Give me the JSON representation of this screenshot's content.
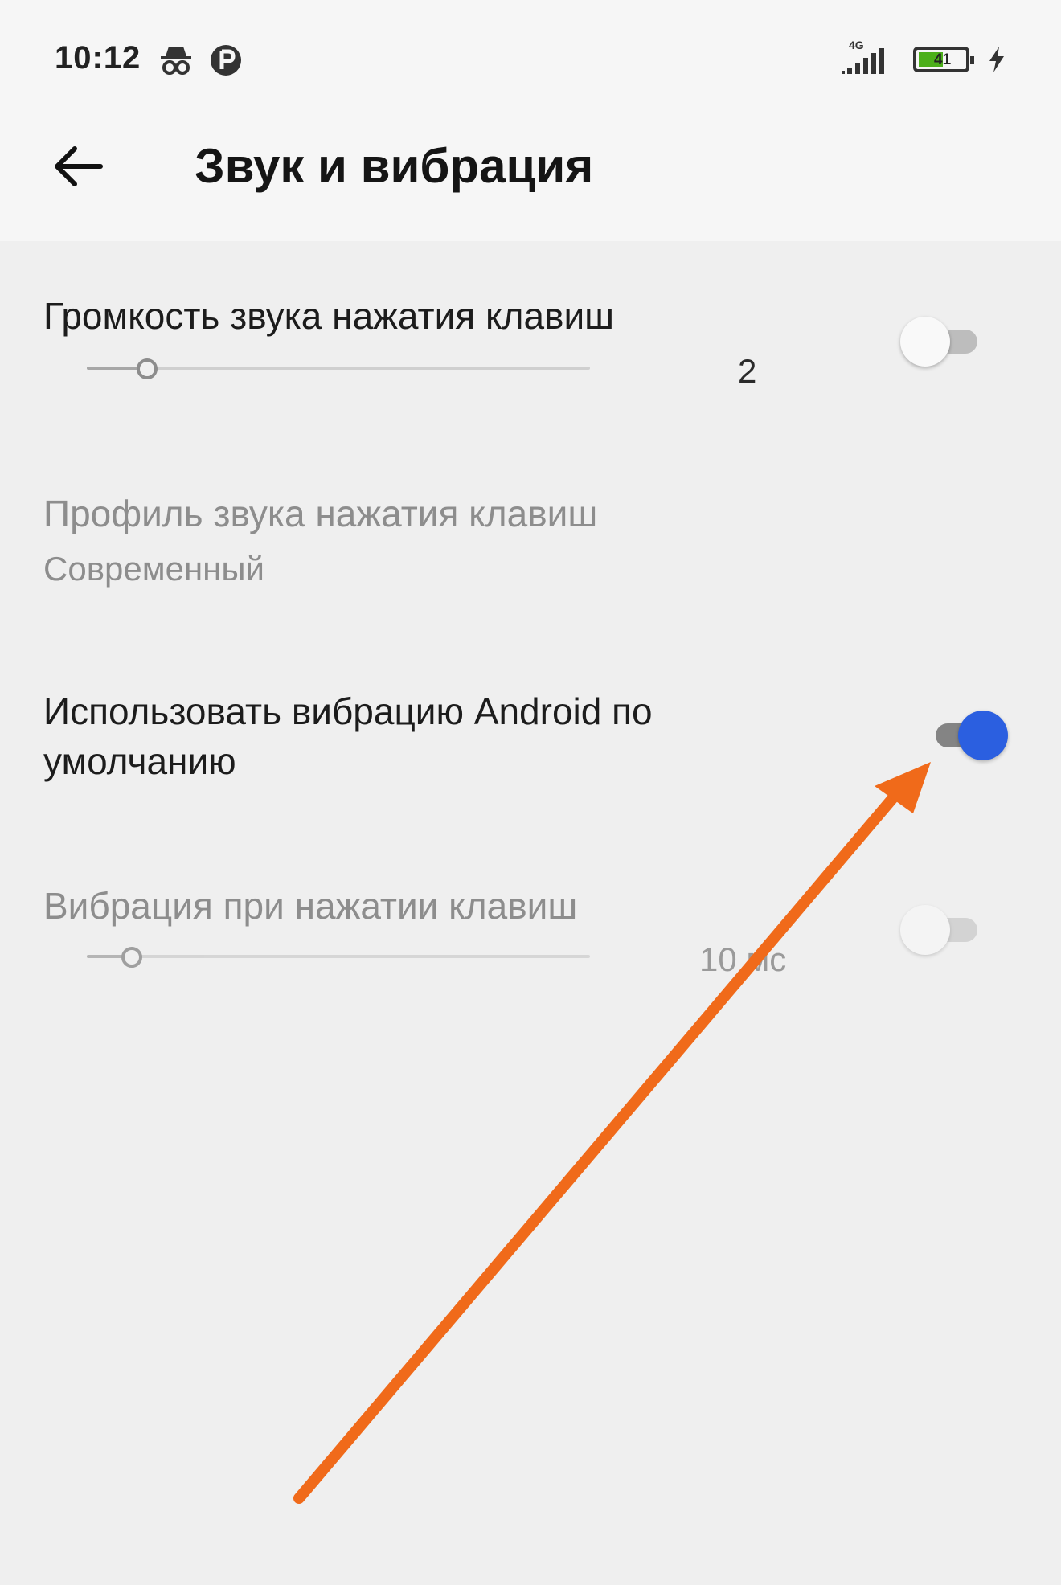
{
  "status_bar": {
    "time": "10:12",
    "icons": [
      "incognito-icon",
      "app-notification-icon",
      "signal-4g-icon",
      "battery-icon",
      "charging-icon"
    ],
    "network_label": "4G",
    "battery_level": "41"
  },
  "app_bar": {
    "back_icon": "arrow-back-icon",
    "title": "Звук и вибрация"
  },
  "settings": {
    "key_sound_volume": {
      "title": "Громкость звука нажатия клавиш",
      "value": "2",
      "level_fraction": 0.12,
      "switch_on": false
    },
    "key_sound_profile": {
      "title": "Профиль звука нажатия клавиш",
      "summary": "Современный",
      "enabled": false
    },
    "android_vibration": {
      "title_line1": "Использовать вибрацию Android по",
      "title_line2": "умолчанию",
      "switch_on": true
    },
    "key_vibration": {
      "title": "Вибрация при нажатии клавиш",
      "value": "10 мс",
      "level_fraction": 0.09,
      "switch_on": false,
      "enabled": false
    }
  },
  "colors": {
    "accent": "#2b5fe0",
    "annotation_arrow": "#f06a1a",
    "background": "#efefef"
  }
}
